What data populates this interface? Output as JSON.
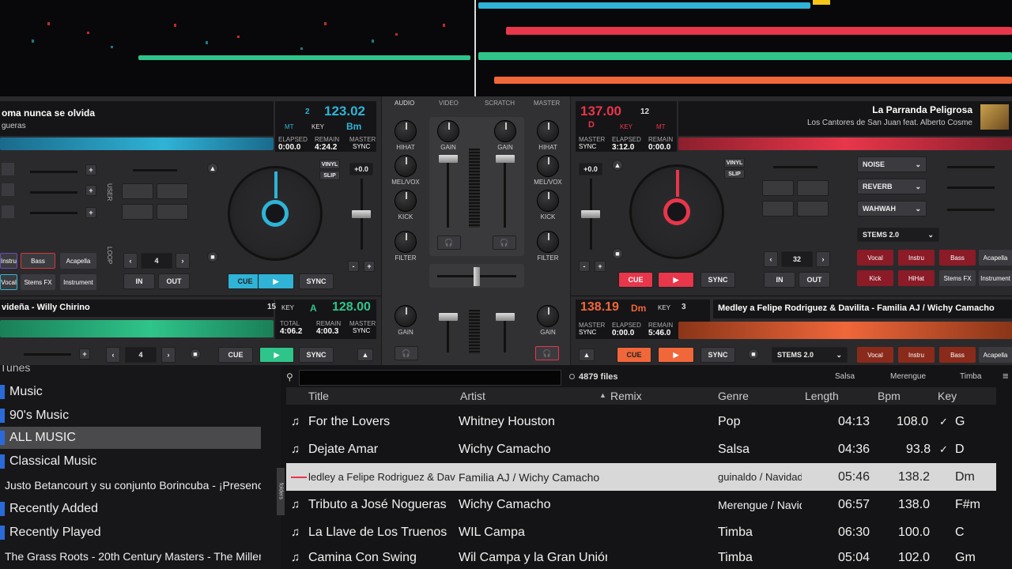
{
  "deckA": {
    "title": "oma nunca se olvida",
    "artist": "gueras",
    "key_label": "KEY",
    "key": "Bm",
    "bpm": "123.02",
    "deck_num": "2",
    "mt": "MT",
    "elapsed_label": "ELAPSED",
    "elapsed": "0:00.0",
    "remain_label": "REMAIN",
    "remain": "4:24.2",
    "master_label": "MASTER",
    "sync_label": "SYNC",
    "vinyl": "VINYL",
    "slip": "SLIP",
    "pitch": "+0.0",
    "loop_val": "4",
    "cue": "CUE",
    "sync": "SYNC",
    "in": "IN",
    "out": "OUT",
    "user": "USER",
    "loop": "LOOP",
    "stems": [
      "Instru",
      "Bass",
      "Acapella",
      "Vocal",
      "Stems FX",
      "Instrument"
    ]
  },
  "deckB": {
    "title": "La Parranda Peligrosa",
    "artist": "Los Cantores de San Juan feat. Alberto Cosme",
    "bpm": "137.00",
    "deck_num": "12",
    "key_letter": "D",
    "key_label": "KEY",
    "mt": "MT",
    "master_label": "MASTER",
    "sync_label": "SYNC",
    "elapsed_label": "ELAPSED",
    "elapsed": "0:00.0",
    "remain_label": "REMAIN",
    "remain": "3:12.0",
    "vinyl": "VINYL",
    "slip": "SLIP",
    "pitch": "+0.0",
    "loop_val": "32",
    "cue": "CUE",
    "sync": "SYNC",
    "in": "IN",
    "out": "OUT",
    "fx": [
      "NOISE",
      "REVERB",
      "WAHWAH"
    ],
    "stems_select": "STEMS 2.0",
    "stems": [
      "Vocal",
      "Instru",
      "Bass",
      "Acapella",
      "Kick",
      "HiHat",
      "Stems FX",
      "Instrument"
    ]
  },
  "deckC": {
    "title": "videña - Willy Chirino",
    "bpm": "128.00",
    "key_label": "KEY",
    "key": "A",
    "deck_num": "15",
    "total_label": "TOTAL",
    "total": "4:06.2",
    "remain_label": "REMAIN",
    "remain": "4:00.3",
    "master_label": "MASTER",
    "sync_label": "SYNC",
    "loop_val": "4",
    "cue": "CUE",
    "sync": "SYNC"
  },
  "deckD": {
    "title": "Medley a Felipe Rodriguez & Davilita - Familia AJ / Wichy Camacho",
    "bpm": "138.19",
    "key": "Dm",
    "key_label": "KEY",
    "deck_num": "3",
    "master_label": "MASTER",
    "sync_label": "SYNC",
    "elapsed_label": "ELAPSED",
    "elapsed": "0:00.0",
    "remain_label": "REMAIN",
    "remain": "5:46.0",
    "cue": "CUE",
    "sync": "SYNC",
    "stems_select": "STEMS 2.0",
    "stems": [
      "Vocal",
      "Instru",
      "Bass",
      "Acapella"
    ]
  },
  "mixer": {
    "tabs": [
      "AUDIO",
      "VIDEO",
      "SCRATCH",
      "MASTER"
    ],
    "knobs_left": [
      "HIHAT",
      "MEL/VOX",
      "KICK",
      "FILTER"
    ],
    "knobs_right": [
      "HIHAT",
      "MEL/VOX",
      "KICK",
      "FILTER"
    ],
    "gain": "GAIN"
  },
  "browser": {
    "file_count": "4879 files",
    "quick_filters": [
      "Salsa",
      "Merengue",
      "Timba"
    ],
    "folders_tab": "folders",
    "tree_header": "Tunes",
    "tree": [
      "Music",
      "90's Music",
      "ALL MUSIC",
      "Classical Music",
      "Justo Betancourt y su conjunto Borincuba - ¡Presencia!",
      "Recently Added",
      "Recently Played",
      "The Grass Roots - 20th Century Masters - The Millennium"
    ],
    "columns": [
      "Title",
      "Artist",
      "Remix",
      "Genre",
      "Length",
      "Bpm",
      "Key"
    ],
    "rows": [
      {
        "title": "For the Lovers",
        "artist": "Whitney Houston",
        "genre": "Pop",
        "length": "04:13",
        "bpm": "108.0",
        "key": "G",
        "check": "✓"
      },
      {
        "title": "Dejate Amar",
        "artist": "Wichy Camacho",
        "genre": "Salsa",
        "length": "04:36",
        "bpm": "93.8",
        "key": "D",
        "check": "✓"
      },
      {
        "title": "ledley a Felipe Rodriguez & Davili",
        "artist": "Familia AJ / Wichy Camacho",
        "genre": "guinaldo / Navidad",
        "length": "05:46",
        "bpm": "138.2",
        "key": "Dm",
        "check": ""
      },
      {
        "title": "Tributo a José Nogueras",
        "artist": "Wichy Camacho",
        "genre": "Merengue / Navida",
        "length": "06:57",
        "bpm": "138.0",
        "key": "F#m",
        "check": ""
      },
      {
        "title": "La Llave de Los Truenos",
        "artist": "WIL Campa",
        "genre": "Timba",
        "length": "06:30",
        "bpm": "100.0",
        "key": "C",
        "check": ""
      },
      {
        "title": "Camina Con Swing",
        "artist": "Wil Campa y la Gran Unión",
        "genre": "Timba",
        "length": "05:04",
        "bpm": "102.0",
        "key": "Gm",
        "check": ""
      }
    ]
  },
  "colors": {
    "deckA": "#2fb3d6",
    "deckB": "#e8364a",
    "deckC": "#2fc48a",
    "deckD": "#f0673a"
  }
}
